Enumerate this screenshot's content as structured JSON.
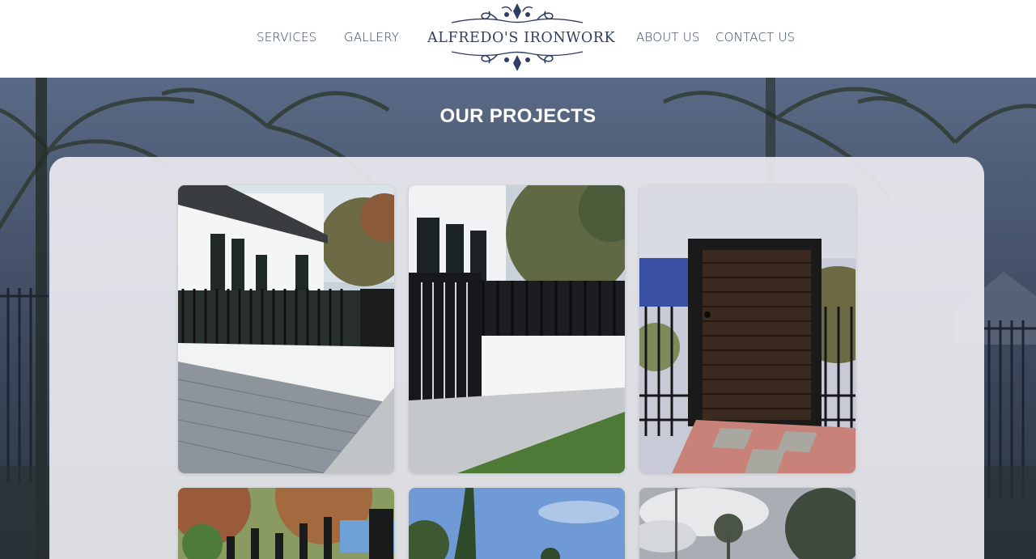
{
  "nav": {
    "services": "SERVICES",
    "gallery": "GALLERY",
    "about": "ABOUT US",
    "contact": "CONTACT US"
  },
  "logo": {
    "text": "ALFREDO'S IRONWORK"
  },
  "section": {
    "title": "OUR PROJECTS"
  },
  "gallery": {
    "items": [
      {
        "name": "modern-house-black-picket-fence"
      },
      {
        "name": "black-slat-gate-white-wall"
      },
      {
        "name": "wood-panel-iron-gate"
      },
      {
        "name": "metal-fence-autumn-trees"
      },
      {
        "name": "palm-trees-blue-sky"
      },
      {
        "name": "cloudy-sky-trees"
      }
    ]
  },
  "colors": {
    "brand_navy": "#2f3e63",
    "header_bg": "#ffffff",
    "panel_bg": "#f0f0f4"
  }
}
